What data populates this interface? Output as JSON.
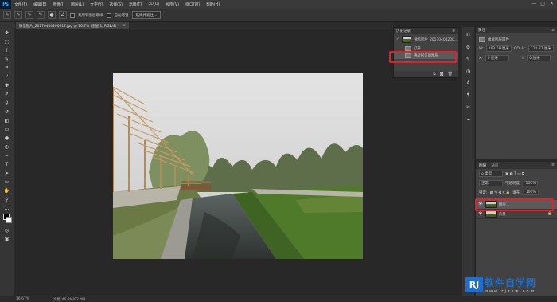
{
  "app": {
    "logo": "Ps"
  },
  "menu": [
    "文件(F)",
    "编辑(E)",
    "图像(I)",
    "图层(L)",
    "文字(Y)",
    "选择(S)",
    "滤镜(T)",
    "3D(D)",
    "视图(V)",
    "窗口(W)",
    "帮助(H)"
  ],
  "window_controls": [
    "—",
    "□",
    "✕"
  ],
  "options": {
    "sample_all_label": "对所有图层取样",
    "auto_enhance_label": "自动增强",
    "refine_edge_label": "选择并遮住..."
  },
  "document": {
    "tab_title": "微信图片_20170404200017.jpg @ 16.7% (图层 1, RGB/8) *",
    "close": "×"
  },
  "history": {
    "title": "历史记录",
    "snapshot_name": "微信图片_20170404200...",
    "items": [
      "打开",
      "通过拷贝的图层"
    ]
  },
  "properties": {
    "title": "属性",
    "subtitle": "像素图层属性",
    "w_label": "W:",
    "w_value": "163.69 厘米",
    "h_label": "H:",
    "h_value": "122.77 厘米",
    "go_label": "GO",
    "x_label": "X:",
    "x_value": "0 厘米",
    "y_label": "Y:",
    "y_value": "0 厘米"
  },
  "layers": {
    "tabs": [
      "图层",
      "通道"
    ],
    "kind": "ρ 类型",
    "blend_mode": "正常",
    "opacity_label": "不透明度:",
    "opacity_value": "100%",
    "lock_label": "锁定:",
    "fill_label": "填充:",
    "fill_value": "100%",
    "rows": [
      {
        "name": "图层 1",
        "selected": true
      },
      {
        "name": "背景",
        "selected": false
      }
    ]
  },
  "status": {
    "zoom": "16.67%",
    "doc_size": "文档:46.2M/92.4M"
  },
  "watermark": {
    "logo": "RJ",
    "title": "软件自学网",
    "url": "www.rjzxw.com"
  },
  "colors": {
    "accent_red": "#e0222b",
    "ps_blue": "#31a8ff",
    "watermark_blue": "#1e6fd0"
  }
}
